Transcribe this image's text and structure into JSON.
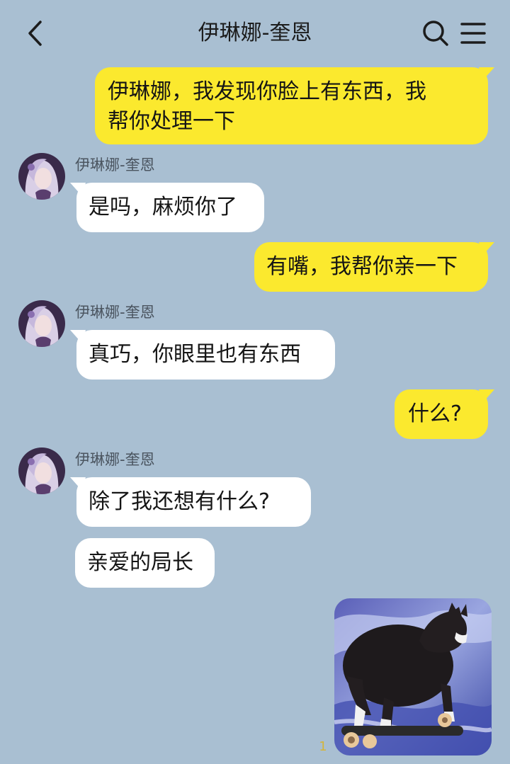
{
  "header": {
    "title": "伊琳娜-奎恩",
    "back_icon": "chevron-left-icon",
    "search_icon": "search-icon",
    "menu_icon": "menu-icon"
  },
  "colors": {
    "background": "#a9bfd2",
    "my_bubble": "#fbe92e",
    "their_bubble": "#ffffff"
  },
  "messages": [
    {
      "from": "me",
      "lines": [
        "伊琳娜，我发现你脸上有东西，我",
        "帮你处理一下"
      ]
    },
    {
      "from": "them",
      "sender": "伊琳娜-奎恩",
      "text": "是吗，麻烦你了"
    },
    {
      "from": "me",
      "text": "有嘴，我帮你亲一下"
    },
    {
      "from": "them",
      "sender": "伊琳娜-奎恩",
      "text": "真巧，你眼里也有东西"
    },
    {
      "from": "me",
      "text": "什么?"
    },
    {
      "from": "them",
      "sender": "伊琳娜-奎恩",
      "text": "除了我还想有什么?"
    },
    {
      "from": "them",
      "text": "亲爱的局长"
    },
    {
      "from": "me",
      "type": "image",
      "image": "cat-on-skateboard",
      "counter": "1"
    }
  ]
}
